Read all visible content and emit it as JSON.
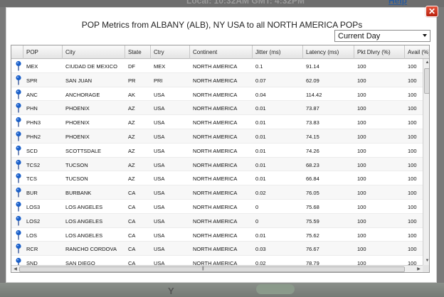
{
  "background": {
    "local_time": "Local: 10:32AM   GMT: 4:32PM",
    "help_link": "Help",
    "y_label": "Y"
  },
  "modal": {
    "title": "POP Metrics from ALBANY (ALB), NY USA to all NORTH AMERICA POPs",
    "period": "Current Day",
    "close_glyph": "✕"
  },
  "table": {
    "columns": [
      "POP",
      "City",
      "State",
      "Ctry",
      "Continent",
      "Jitter (ms)",
      "Latency (ms)",
      "Pkt Dlvry (%)",
      "Avail (%)"
    ],
    "rows": [
      [
        "MEX",
        "CIUDAD DE MEXICO",
        "DF",
        "MEX",
        "NORTH AMERICA",
        "0.1",
        "91.14",
        "100",
        "100"
      ],
      [
        "SPR",
        "SAN JUAN",
        "PR",
        "PRI",
        "NORTH AMERICA",
        "0.07",
        "62.09",
        "100",
        "100"
      ],
      [
        "ANC",
        "ANCHORAGE",
        "AK",
        "USA",
        "NORTH AMERICA",
        "0.04",
        "114.42",
        "100",
        "100"
      ],
      [
        "PHN",
        "PHOENIX",
        "AZ",
        "USA",
        "NORTH AMERICA",
        "0.01",
        "73.87",
        "100",
        "100"
      ],
      [
        "PHN3",
        "PHOENIX",
        "AZ",
        "USA",
        "NORTH AMERICA",
        "0.01",
        "73.83",
        "100",
        "100"
      ],
      [
        "PHN2",
        "PHOENIX",
        "AZ",
        "USA",
        "NORTH AMERICA",
        "0.01",
        "74.15",
        "100",
        "100"
      ],
      [
        "SCD",
        "SCOTTSDALE",
        "AZ",
        "USA",
        "NORTH AMERICA",
        "0.01",
        "74.26",
        "100",
        "100"
      ],
      [
        "TCS2",
        "TUCSON",
        "AZ",
        "USA",
        "NORTH AMERICA",
        "0.01",
        "68.23",
        "100",
        "100"
      ],
      [
        "TCS",
        "TUCSON",
        "AZ",
        "USA",
        "NORTH AMERICA",
        "0.01",
        "66.84",
        "100",
        "100"
      ],
      [
        "BUR",
        "BURBANK",
        "CA",
        "USA",
        "NORTH AMERICA",
        "0.02",
        "76.05",
        "100",
        "100"
      ],
      [
        "LOS3",
        "LOS ANGELES",
        "CA",
        "USA",
        "NORTH AMERICA",
        "0",
        "75.68",
        "100",
        "100"
      ],
      [
        "LOS2",
        "LOS ANGELES",
        "CA",
        "USA",
        "NORTH AMERICA",
        "0",
        "75.59",
        "100",
        "100"
      ],
      [
        "LOS",
        "LOS ANGELES",
        "CA",
        "USA",
        "NORTH AMERICA",
        "0.01",
        "75.62",
        "100",
        "100"
      ],
      [
        "RCR",
        "RANCHO CORDOVA",
        "CA",
        "USA",
        "NORTH AMERICA",
        "0.03",
        "76.67",
        "100",
        "100"
      ],
      [
        "SND",
        "SAN DIEGO",
        "CA",
        "USA",
        "NORTH AMERICA",
        "0.02",
        "78.79",
        "100",
        "100"
      ]
    ]
  },
  "colors": {
    "pin": "#1a5fc8",
    "close": "#c8321e"
  },
  "icons": {
    "row_marker": "map-pin-icon",
    "close": "close-icon"
  }
}
